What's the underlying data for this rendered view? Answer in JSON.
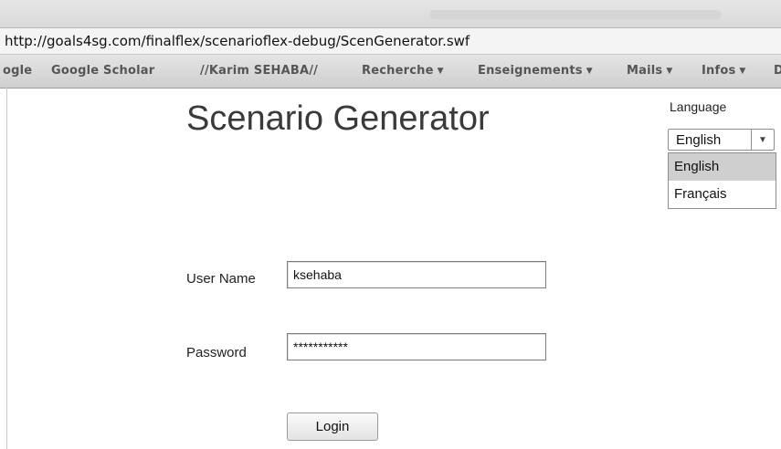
{
  "browser": {
    "url": "http://goals4sg.com/finalflex/scenarioflex-debug/ScenGenerator.swf",
    "bookmarks": [
      {
        "label": "ogle",
        "has_menu": false
      },
      {
        "label": "Google Scholar",
        "has_menu": false
      },
      {
        "label": "//Karim SEHABA//",
        "has_menu": false
      },
      {
        "label": "Recherche",
        "has_menu": true
      },
      {
        "label": "Enseignements",
        "has_menu": true
      },
      {
        "label": "Mails",
        "has_menu": true
      },
      {
        "label": "Infos",
        "has_menu": true
      },
      {
        "label": "D",
        "has_menu": false
      }
    ],
    "menu_caret": "▼"
  },
  "app": {
    "title": "Scenario Generator",
    "language": {
      "label": "Language",
      "selected": "English",
      "options": [
        "English",
        "Français"
      ],
      "highlighted_option": "English"
    },
    "form": {
      "username_label": "User Name",
      "username_value": "ksehaba",
      "password_label": "Password",
      "password_value": "***********",
      "login_label": "Login"
    }
  }
}
